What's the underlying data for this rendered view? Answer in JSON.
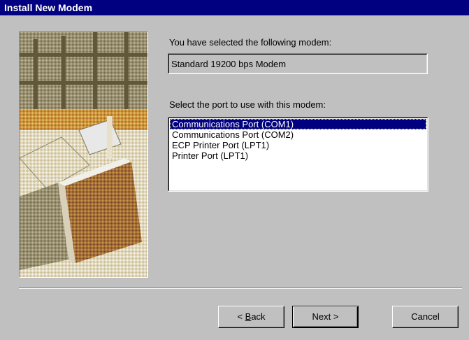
{
  "window": {
    "title": "Install New Modem"
  },
  "modem": {
    "label": "You have selected the following modem:",
    "value": "Standard 19200 bps Modem"
  },
  "ports": {
    "label": "Select the port to use with this modem:",
    "items": [
      "Communications Port (COM1)",
      "Communications Port (COM2)",
      "ECP Printer Port (LPT1)",
      "Printer Port (LPT1)"
    ],
    "selected": "Communications Port (COM1)"
  },
  "buttons": {
    "back_prefix": "< ",
    "back_accel": "B",
    "back_rest": "ack",
    "next": "Next >",
    "cancel": "Cancel"
  },
  "colors": {
    "face": "#c0c0c0",
    "titlebar": "#000080",
    "selection": "#000080"
  },
  "illustration": {
    "icon": "computer-desk-artwork"
  }
}
